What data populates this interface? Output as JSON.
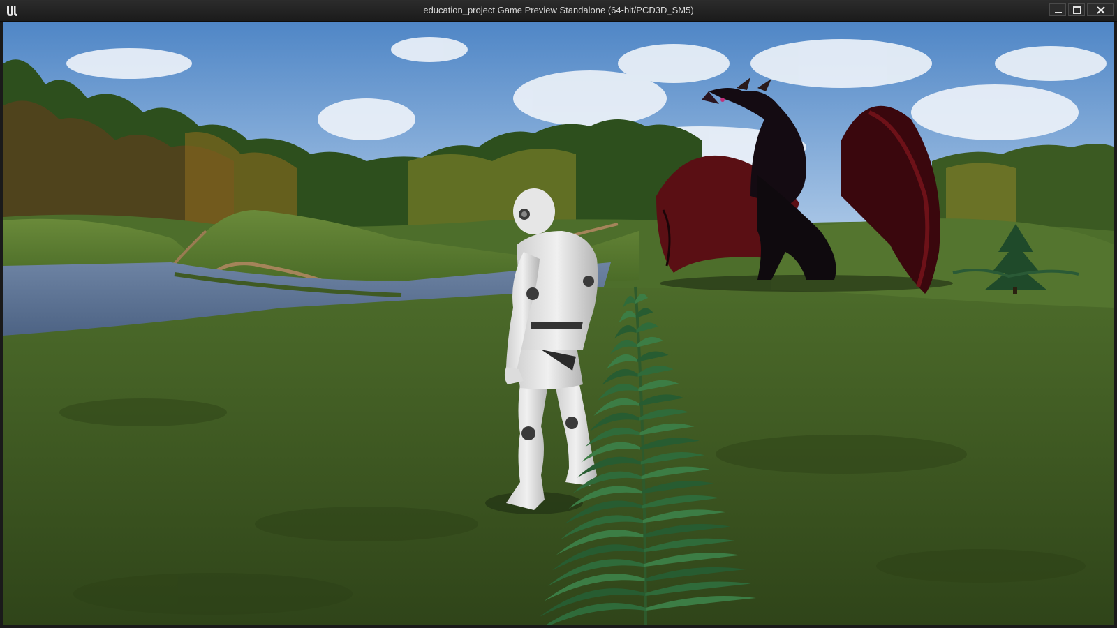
{
  "window": {
    "title": "education_project Game Preview Standalone (64-bit/PCD3D_SM5)",
    "app_icon": "unreal-engine-logo",
    "controls": {
      "minimize": "minimize-icon",
      "maximize": "maximize-icon",
      "close": "close-icon"
    }
  },
  "scene": {
    "sky_color": "#6e9ed4",
    "grass_color": "#3f5a23",
    "water_color": "#5a6f8e",
    "elements": [
      "sky",
      "clouds",
      "tree-line",
      "hills",
      "river",
      "mannequin-character",
      "dragon",
      "fern",
      "pine-sapling"
    ]
  }
}
